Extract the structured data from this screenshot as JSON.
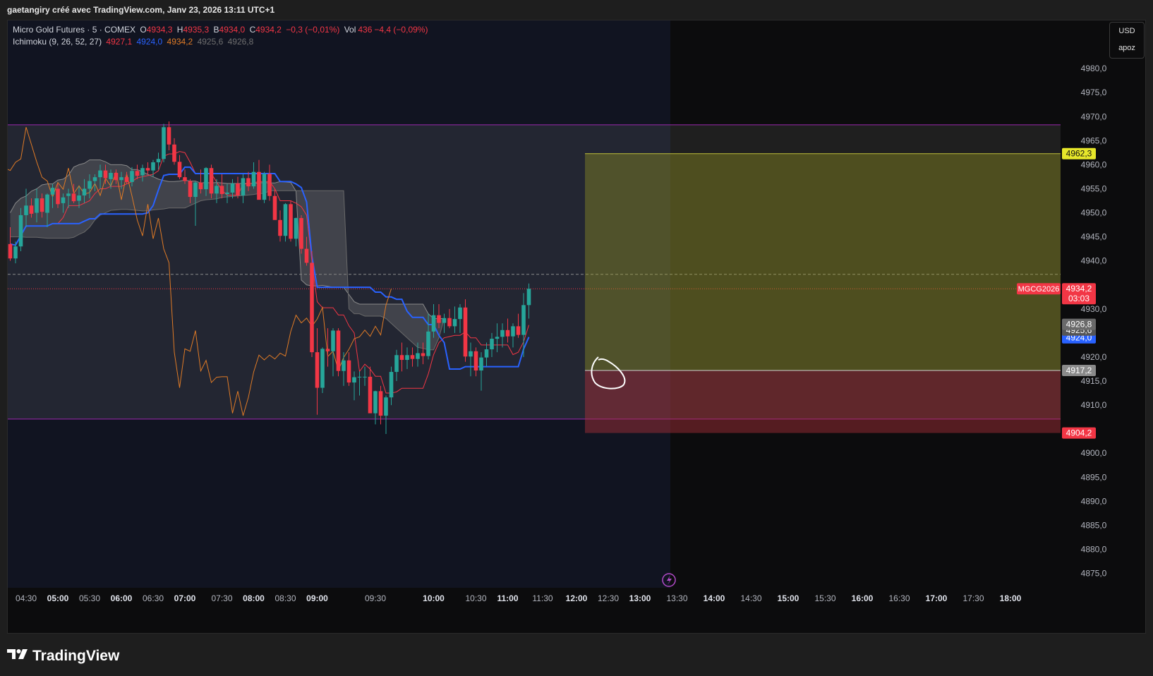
{
  "header": {
    "attribution": "gaetangiry créé avec TradingView.com, Janv 23, 2026 13:11 UTC+1"
  },
  "legend": {
    "symbol": "Micro Gold Futures · 5 · COMEX",
    "o_label": "O",
    "o_value": "4934,3",
    "h_label": "H",
    "h_value": "4935,3",
    "b_label": "B",
    "b_value": "4934,0",
    "c_label": "C",
    "c_value": "4934,2",
    "change": "−0,3 (−0,01%)",
    "vol_label": "Vol",
    "vol_value": "436",
    "vol_change": "−4,4 (−0,09%)",
    "indicator": "Ichimoku (9, 26, 52, 27)",
    "ind_values": [
      "4927,1",
      "4924,0",
      "4934,2",
      "4925,6",
      "4926,8"
    ]
  },
  "scale_box": {
    "currency": "USD",
    "mode": "apoz"
  },
  "footer": {
    "brand": "TradingView"
  },
  "colors": {
    "up": "#26a69a",
    "down": "#f23645",
    "tenkan": "#f23645",
    "kijun": "#2962ff",
    "chikou": "#e07b26",
    "cloud": "#7a7a7a",
    "range_line": "#9c27b0",
    "target": "#e0e02a",
    "stop": "#f23645"
  },
  "chart_data": {
    "type": "candlestick",
    "symbol": "MGCG2026",
    "interval": "5",
    "ylim": [
      4872,
      4990
    ],
    "y_ticks": [
      4980,
      4975,
      4970,
      4965,
      4960,
      4955,
      4950,
      4945,
      4940,
      4930,
      4920,
      4915,
      4910,
      4900,
      4895,
      4890,
      4885,
      4880,
      4875
    ],
    "y_tick_labels": [
      "4980,0",
      "4975,0",
      "4970,0",
      "4965,0",
      "4960,0",
      "4955,0",
      "4950,0",
      "4945,0",
      "4940,0",
      "4930,0",
      "4920,0",
      "4915,0",
      "4910,0",
      "4900,0",
      "4895,0",
      "4890,0",
      "4885,0",
      "4880,0",
      "4875,0"
    ],
    "x_ticks": [
      {
        "label": "04:30",
        "bar": 3,
        "bold": false
      },
      {
        "label": "05:00",
        "bar": 9,
        "bold": true
      },
      {
        "label": "05:30",
        "bar": 15,
        "bold": false
      },
      {
        "label": "06:00",
        "bar": 21,
        "bold": true
      },
      {
        "label": "06:30",
        "bar": 27,
        "bold": false
      },
      {
        "label": "07:00",
        "bar": 33,
        "bold": true
      },
      {
        "label": "07:30",
        "bar": 40,
        "bold": false
      },
      {
        "label": "08:00",
        "bar": 46,
        "bold": true
      },
      {
        "label": "08:30",
        "bar": 52,
        "bold": false
      },
      {
        "label": "09:00",
        "bar": 58,
        "bold": true
      },
      {
        "label": "09:30",
        "bar": 69,
        "bold": false
      },
      {
        "label": "10:00",
        "bar": 80,
        "bold": true
      },
      {
        "label": "10:30",
        "bar": 88,
        "bold": false
      },
      {
        "label": "11:00",
        "bar": 94,
        "bold": true
      },
      {
        "label": "11:30",
        "bar": 100.6,
        "bold": false
      },
      {
        "label": "12:00",
        "bar": 107,
        "bold": true
      },
      {
        "label": "12:30",
        "bar": 113,
        "bold": false
      },
      {
        "label": "13:00",
        "bar": 119,
        "bold": true
      },
      {
        "label": "13:30",
        "bar": 126,
        "bold": false
      },
      {
        "label": "14:00",
        "bar": 133,
        "bold": true
      },
      {
        "label": "14:30",
        "bar": 140,
        "bold": false
      },
      {
        "label": "15:00",
        "bar": 147,
        "bold": true
      },
      {
        "label": "15:30",
        "bar": 154,
        "bold": false
      },
      {
        "label": "16:00",
        "bar": 161,
        "bold": true
      },
      {
        "label": "16:30",
        "bar": 168,
        "bold": false
      },
      {
        "label": "17:00",
        "bar": 175,
        "bold": true
      },
      {
        "label": "17:30",
        "bar": 182,
        "bold": false
      },
      {
        "label": "18:00",
        "bar": 189,
        "bold": true
      }
    ],
    "candles": [
      [
        4943.5,
        4947,
        4940,
        4940.5
      ],
      [
        4940.5,
        4944,
        4939.5,
        4943
      ],
      [
        4943,
        4951,
        4942,
        4949.5
      ],
      [
        4949.5,
        4955,
        4947,
        4951.5
      ],
      [
        4951.5,
        4953,
        4949,
        4949.8
      ],
      [
        4950,
        4955,
        4948,
        4953
      ],
      [
        4953,
        4954,
        4949,
        4950.2
      ],
      [
        4950,
        4954,
        4947,
        4953.8
      ],
      [
        4953.8,
        4956,
        4951,
        4955.2
      ],
      [
        4955,
        4956,
        4951,
        4951.8
      ],
      [
        4952,
        4954,
        4950,
        4953.2
      ],
      [
        4953.5,
        4955,
        4951,
        4954
      ],
      [
        4954,
        4956,
        4952,
        4952.4
      ],
      [
        4952.5,
        4955.5,
        4951,
        4953.6
      ],
      [
        4953.6,
        4957,
        4952,
        4955
      ],
      [
        4955,
        4958,
        4953,
        4956.6
      ],
      [
        4956.6,
        4958,
        4954.5,
        4957.4
      ],
      [
        4957.4,
        4960,
        4955,
        4958.8
      ],
      [
        4958.8,
        4960,
        4956,
        4957.2
      ],
      [
        4957,
        4959,
        4955,
        4958.3
      ],
      [
        4958.3,
        4959,
        4956,
        4956.8
      ],
      [
        4956.8,
        4958.5,
        4955,
        4957.4
      ],
      [
        4957.4,
        4958.5,
        4956,
        4956.4
      ],
      [
        4956.4,
        4959.5,
        4955.5,
        4958.7
      ],
      [
        4958.7,
        4960,
        4957,
        4957.7
      ],
      [
        4957.8,
        4960,
        4956.5,
        4959.3
      ],
      [
        4959.3,
        4960.5,
        4958,
        4958.8
      ],
      [
        4958.8,
        4961,
        4957.5,
        4960.5
      ],
      [
        4960.5,
        4962.5,
        4959,
        4961.2
      ],
      [
        4961.2,
        4968.5,
        4960.5,
        4967.8
      ],
      [
        4967.8,
        4969,
        4963,
        4964.2
      ],
      [
        4964.2,
        4965.5,
        4960,
        4960.6
      ],
      [
        4960.6,
        4962,
        4957,
        4957.4
      ],
      [
        4957.4,
        4959,
        4956,
        4956.6
      ],
      [
        4956.6,
        4957,
        4952,
        4953.3
      ],
      [
        4953.3,
        4956.5,
        4947.3,
        4956.3
      ],
      [
        4956.3,
        4959,
        4954,
        4954.9
      ],
      [
        4954.9,
        4959.5,
        4953.5,
        4959.3
      ],
      [
        4959.3,
        4960,
        4953,
        4954
      ],
      [
        4954,
        4957,
        4952,
        4955.6
      ],
      [
        4955.6,
        4958,
        4953,
        4953.9
      ],
      [
        4953.9,
        4956,
        4952,
        4954.2
      ],
      [
        4954.2,
        4957,
        4953,
        4956.1
      ],
      [
        4956.1,
        4957.5,
        4953,
        4953.6
      ],
      [
        4953.6,
        4958,
        4952,
        4957.2
      ],
      [
        4957.2,
        4958.5,
        4954.5,
        4955.5
      ],
      [
        4955.5,
        4960.5,
        4955,
        4958.5
      ],
      [
        4958.5,
        4961,
        4955,
        4952.7
      ],
      [
        4952.7,
        4958.5,
        4952,
        4958.1
      ],
      [
        4958.1,
        4960,
        4952.5,
        4953.5
      ],
      [
        4953.5,
        4955,
        4949,
        4948.5
      ],
      [
        4948.5,
        4950.5,
        4944,
        4945.2
      ],
      [
        4945.2,
        4952,
        4944,
        4951.8
      ],
      [
        4951.8,
        4952.5,
        4944,
        4944.6
      ],
      [
        4944.6,
        4949,
        4943,
        4948.9
      ],
      [
        4948.9,
        4949.5,
        4941.5,
        4942.5
      ],
      [
        4942.5,
        4945,
        4939,
        4939.6
      ],
      [
        4939.6,
        4942,
        4920,
        4921
      ],
      [
        4921,
        4926,
        4908,
        4913.6
      ],
      [
        4913.6,
        4922,
        4912.5,
        4921.7
      ],
      [
        4921.7,
        4926,
        4918,
        4921.2
      ],
      [
        4921.2,
        4926,
        4916,
        4925.5
      ],
      [
        4925.5,
        4926,
        4916,
        4917.1
      ],
      [
        4917.1,
        4921,
        4914,
        4919.3
      ],
      [
        4919.3,
        4921,
        4914,
        4914.7
      ],
      [
        4914.7,
        4917,
        4911,
        4915.8
      ],
      [
        4915.8,
        4917,
        4912,
        4915.9
      ],
      [
        4915.9,
        4918,
        4914,
        4915.9
      ],
      [
        4915.9,
        4918,
        4909,
        4908.3
      ],
      [
        4908.3,
        4913,
        4906,
        4912.9
      ],
      [
        4912.9,
        4914,
        4906,
        4907.8
      ],
      [
        4907.8,
        4912,
        4904,
        4911.6
      ],
      [
        4911.6,
        4918,
        4910,
        4916.9
      ],
      [
        4916.9,
        4921.5,
        4915,
        4920.4
      ],
      [
        4920.4,
        4923,
        4917,
        4919.4
      ],
      [
        4919.4,
        4922,
        4917.5,
        4920.4
      ],
      [
        4920.4,
        4922,
        4918,
        4919.6
      ],
      [
        4919.6,
        4923,
        4918,
        4920.8
      ],
      [
        4920.8,
        4923,
        4918.5,
        4920.2
      ],
      [
        4920.2,
        4929,
        4919.5,
        4925.3
      ],
      [
        4925.3,
        4931,
        4924,
        4928.7
      ],
      [
        4928.7,
        4931,
        4926,
        4927.1
      ],
      [
        4927.1,
        4929,
        4925,
        4928.1
      ],
      [
        4928.1,
        4930,
        4926,
        4926.4
      ],
      [
        4926.4,
        4930.5,
        4925,
        4927.9
      ],
      [
        4927.9,
        4931,
        4925,
        4930.3
      ],
      [
        4930.3,
        4932,
        4919,
        4920.1
      ],
      [
        4920.1,
        4923,
        4916,
        4921.2
      ],
      [
        4921.2,
        4922,
        4916,
        4917.2
      ],
      [
        4917.2,
        4921,
        4913,
        4919.9
      ],
      [
        4919.9,
        4923,
        4918,
        4921.6
      ],
      [
        4921.6,
        4925,
        4920,
        4923.8
      ],
      [
        4923.8,
        4927,
        4921,
        4924.2
      ],
      [
        4924.2,
        4927,
        4922,
        4925.6
      ],
      [
        4925.6,
        4928,
        4923,
        4924.3
      ],
      [
        4924.3,
        4927,
        4922,
        4926.4
      ],
      [
        4926.4,
        4929,
        4924,
        4924.6
      ],
      [
        4924.6,
        4933.3,
        4920,
        4930.8
      ],
      [
        4930.8,
        4935.3,
        4928,
        4934.2
      ]
    ],
    "cloud_a": [
      4950,
      4952,
      4953,
      4953.5,
      4954.5,
      4955,
      4955.8,
      4956,
      4956,
      4956.8,
      4957,
      4957.8,
      4959.5,
      4960,
      4960.3,
      4961,
      4961,
      4961,
      4960.6,
      4960,
      4960,
      4960,
      4959.8,
      4959,
      4959,
      4958.5,
      4958,
      4957.5,
      4957,
      4956.7,
      4956.5,
      4956.5,
      4956.6,
      4956.8,
      4956.6,
      4956.6,
      4956.2,
      4956.3,
      4956.2,
      4956.3,
      4956.2,
      4956.1,
      4956.1,
      4956.1,
      4956.1,
      4956.1,
      4956.1,
      4956.2,
      4956.3,
      4956.2,
      4956.2,
      4956.5,
      4956.4,
      4956.3,
      4954.5,
      4936,
      4935,
      4934.8,
      4934.8,
      4934.9,
      4934.7,
      4934.5,
      4934.5,
      4934.5,
      4933,
      4931.5,
      4931,
      4931,
      4931,
      4931,
      4931,
      4931,
      4931,
      4931,
      4931,
      4931,
      4931,
      4931,
      4931,
      4929,
      4928,
      4928,
      4928
    ],
    "cloud_b": [
      4945,
      4945,
      4945,
      4944.9,
      4944.9,
      4944.9,
      4944.8,
      4944.7,
      4944.7,
      4944.7,
      4944.7,
      4944.7,
      4944.9,
      4945.5,
      4946,
      4947,
      4948.5,
      4949.5,
      4950,
      4950.5,
      4950.6,
      4950.7,
      4950.7,
      4950.6,
      4950.5,
      4950.4,
      4950.4,
      4950.6,
      4950.7,
      4950.8,
      4951,
      4951,
      4951,
      4951,
      4951.5,
      4952,
      4952.5,
      4952.7,
      4952.8,
      4952.9,
      4953.2,
      4953.3,
      4953.4,
      4953.5,
      4953.6,
      4953.7,
      4953.8,
      4954,
      4954,
      4954.6,
      4954.6,
      4954.6,
      4954.6,
      4954.6,
      4954.6,
      4954.6,
      4954.6,
      4954.6,
      4954.6,
      4954.6,
      4954.6,
      4954.6,
      4954.6,
      4954.6,
      4930,
      4929,
      4929,
      4928.5,
      4928.5,
      4928.5,
      4928.5,
      4928,
      4927,
      4926,
      4925,
      4924,
      4923,
      4922,
      4921.8,
      4921.5,
      4921.5,
      4924,
      4928
    ],
    "chikou_offset": 26,
    "levels": {
      "upper": 4968.3,
      "lower": 4907.1,
      "dashed": 4937.2,
      "last": 4934.2
    },
    "position": {
      "start_bar": 109,
      "entry": 4917.2,
      "target": 4962.3,
      "stop": 4904.2,
      "target_label": "4962,3",
      "entry_label": "4917,2",
      "stop_label": "4904,2"
    },
    "price_tags": [
      {
        "label": "4934,2",
        "sublabel": "03:03",
        "value": 4934.2,
        "color": "#f23645"
      },
      {
        "label": "4926,8",
        "value": 4926.8,
        "color": "#6a6a6a"
      },
      {
        "label": "4925,6",
        "value": 4925.6,
        "color": "#555555"
      },
      {
        "label": "4924,0",
        "value": 4924.0,
        "color": "#2962ff"
      }
    ],
    "symbol_tag": "MGCG2026"
  }
}
